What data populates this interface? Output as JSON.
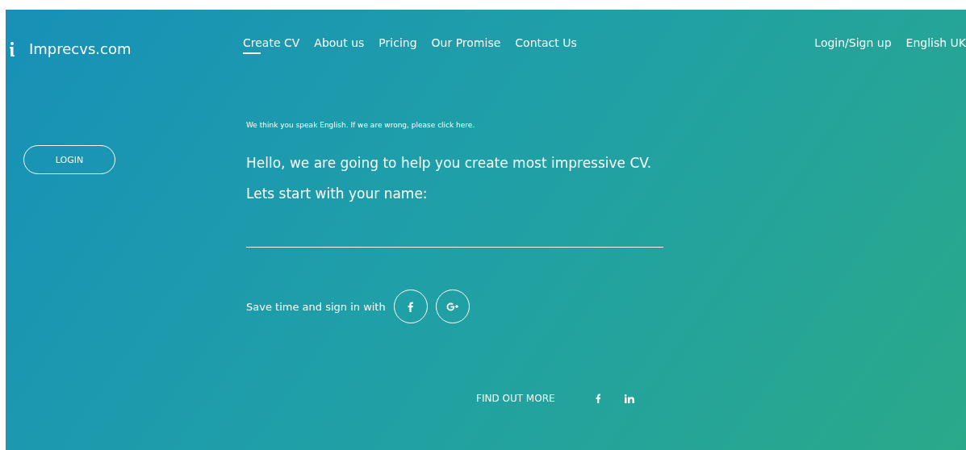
{
  "brand": {
    "name": "Imprecvs.com"
  },
  "nav": [
    {
      "label": "Create CV",
      "selected": true
    },
    {
      "label": "About us",
      "selected": false
    },
    {
      "label": "Pricing",
      "selected": false
    },
    {
      "label": "Our Promise",
      "selected": false
    },
    {
      "label": "Contact Us",
      "selected": false
    }
  ],
  "account_links": [
    "Login/Sign up",
    "English UK"
  ],
  "login_button": "LOGIN",
  "language_notice": "We think you speak English. If we are wrong, please click here.",
  "greeting": "Hello, we are going to help you create most impressive CV.",
  "name_prompt": "Lets start with your name:",
  "social_signin": {
    "label": "Save time and sign in with",
    "providers": [
      {
        "kind": "facebook"
      },
      {
        "kind": "google"
      }
    ]
  },
  "footer": {
    "link": "FIND OUT MORE",
    "socials": [
      {
        "kind": "facebook"
      },
      {
        "kind": "linkedin"
      }
    ]
  }
}
